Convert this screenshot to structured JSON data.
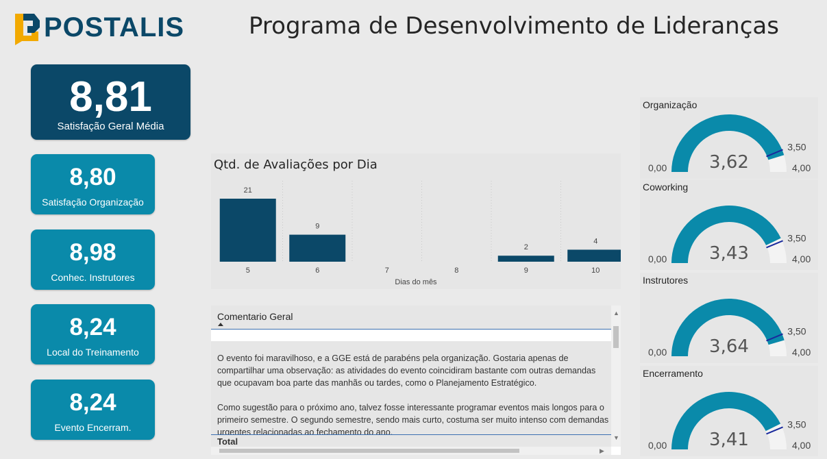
{
  "header": {
    "logo_text": "POSTALIS",
    "title": "Programa de Desenvolvimento de Lideranças"
  },
  "kpis": {
    "main": {
      "value": "8,81",
      "label": "Satisfação Geral Média"
    },
    "items": [
      {
        "value": "8,80",
        "label": "Satisfação Organização"
      },
      {
        "value": "8,98",
        "label": "Conhec. Instrutores"
      },
      {
        "value": "8,24",
        "label": "Local do Treinamento"
      },
      {
        "value": "8,24",
        "label": "Evento Encerram."
      }
    ]
  },
  "chart_data": {
    "type": "bar",
    "title": "Qtd. de Avaliações por Dia",
    "xlabel": "Dias do mês",
    "ylabel": "",
    "categories": [
      "5",
      "6",
      "7",
      "8",
      "9",
      "10"
    ],
    "values": [
      21,
      9,
      null,
      null,
      2,
      4
    ],
    "data_labels": [
      "21",
      "9",
      "",
      "",
      "2",
      "4"
    ],
    "ylim": [
      0,
      21
    ],
    "grid": "vertical dotted",
    "color": "#0b4868"
  },
  "comments": {
    "header": "Comentario Geral",
    "rows": [
      "",
      "O evento foi maravilhoso, e a GGE está de parabéns pela organização. Gostaria apenas de compartilhar uma observação: as atividades do evento coincidiram bastante com outras demandas que ocupavam boa parte das manhãs ou tardes, como o Planejamento Estratégico.",
      "Como sugestão para o próximo ano, talvez fosse interessante programar eventos mais longos para o primeiro semestre. O segundo semestre, sendo mais curto, costuma ser muito intenso com demandas urgentes relacionadas ao fechamento do ano."
    ],
    "total_label": "Total"
  },
  "gauges": [
    {
      "title": "Organização",
      "value": 3.62,
      "value_label": "3,62",
      "min_label": "0,00",
      "max_label": "4,00",
      "target": 3.5,
      "target_label": "3,50"
    },
    {
      "title": "Coworking",
      "value": 3.43,
      "value_label": "3,43",
      "min_label": "0,00",
      "max_label": "4,00",
      "target": 3.5,
      "target_label": "3,50"
    },
    {
      "title": "Instrutores",
      "value": 3.64,
      "value_label": "3,64",
      "min_label": "0,00",
      "max_label": "4,00",
      "target": 3.5,
      "target_label": "3,50"
    },
    {
      "title": "Encerramento",
      "value": 3.41,
      "value_label": "3,41",
      "min_label": "0,00",
      "max_label": "4,00",
      "target": 3.5,
      "target_label": "3,50"
    }
  ],
  "colors": {
    "brand_dark": "#0b4868",
    "brand_teal": "#0a8aaa",
    "logo_accent": "#f2a900",
    "target_line": "#1a2a9c",
    "gauge_bg": "#f3f3f3"
  }
}
